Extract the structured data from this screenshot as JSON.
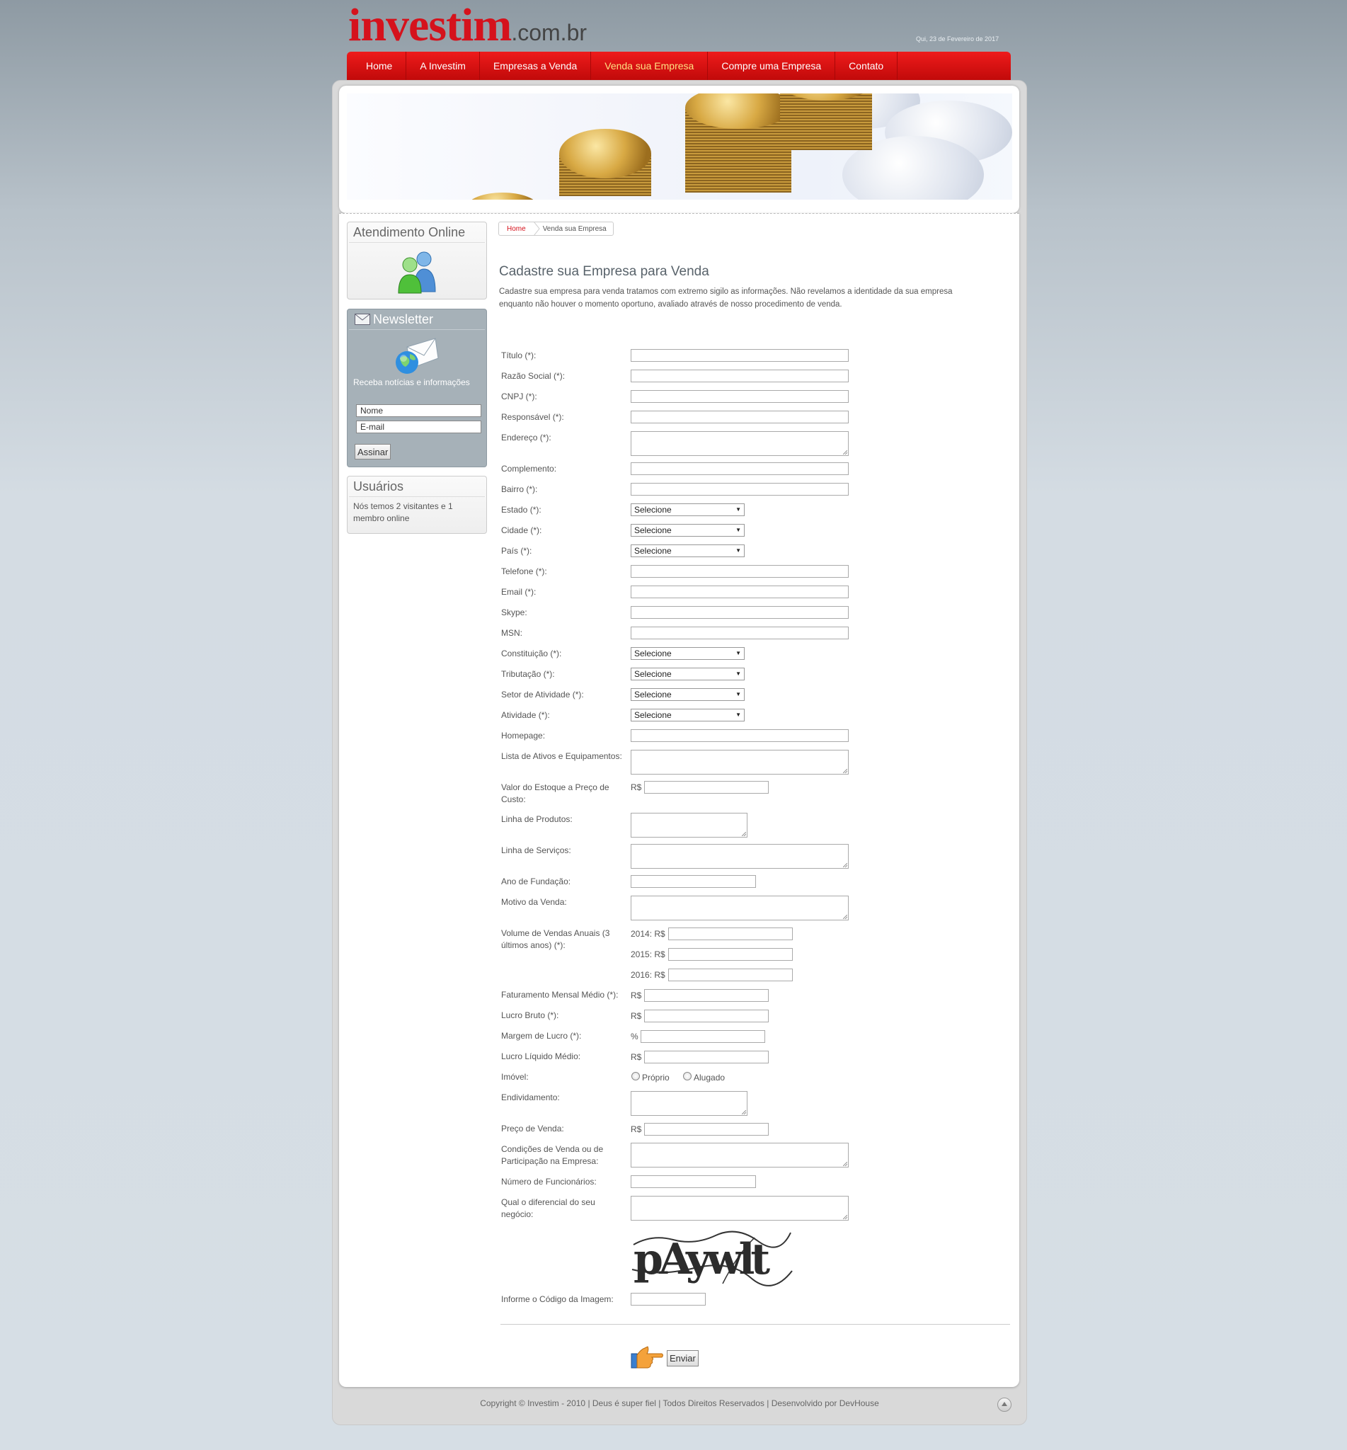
{
  "header": {
    "logo_main": "investim",
    "logo_sub": ".com.br",
    "date": "Qui, 23 de Fevereiro de 2017"
  },
  "nav": [
    {
      "label": "Home",
      "active": false
    },
    {
      "label": "A Investim",
      "active": false
    },
    {
      "label": "Empresas a Venda",
      "active": false
    },
    {
      "label": "Venda sua Empresa",
      "active": true
    },
    {
      "label": "Compre uma Empresa",
      "active": false
    },
    {
      "label": "Contato",
      "active": false
    }
  ],
  "sidebar": {
    "online": {
      "title": "Atendimento Online",
      "icon": "users-icon"
    },
    "newsletter": {
      "title": "Newsletter",
      "icon": "newsletter-globe-icon",
      "text": "Receba notícias e informações",
      "name_value": "Nome",
      "email_value": "E-mail",
      "button": "Assinar"
    },
    "users": {
      "title": "Usuários",
      "text": "Nós temos 2 visitantes e 1 membro online"
    }
  },
  "breadcrumb": {
    "home": "Home",
    "current": "Venda sua Empresa"
  },
  "main": {
    "title": "Cadastre sua Empresa para Venda",
    "intro": "Cadastre sua empresa para venda tratamos com extremo sigilo as informações. Não revelamos a identidade da sua empresa enquanto não houver o momento oportuno, avaliado através de nosso procedimento de venda."
  },
  "form": {
    "titulo": "Título (*):",
    "razao": "Razão Social (*):",
    "cnpj": "CNPJ (*):",
    "responsavel": "Responsável (*):",
    "endereco": "Endereço (*):",
    "complemento": "Complemento:",
    "bairro": "Bairro (*):",
    "estado": "Estado (*):",
    "cidade": "Cidade (*):",
    "pais": "País (*):",
    "telefone": "Telefone (*):",
    "email": "Email (*):",
    "skype": "Skype:",
    "msn": "MSN:",
    "constituicao": "Constituição (*):",
    "tributacao": "Tributação (*):",
    "setor": "Setor de Atividade (*):",
    "atividade": "Atividade (*):",
    "homepage": "Homepage:",
    "ativos": "Lista de Ativos e Equipamentos:",
    "estoque": "Valor do Estoque a Preço de Custo:",
    "produtos": "Linha de Produtos:",
    "servicos": "Linha de Serviços:",
    "fundacao": "Ano de Fundação:",
    "motivo": "Motivo da Venda:",
    "volume": "Volume de Vendas Anuais (3 últimos anos) (*):",
    "faturamento": "Faturamento Mensal Médio (*):",
    "lucro_bruto": "Lucro Bruto (*):",
    "margem": "Margem de Lucro (*):",
    "lucro_liquido": "Lucro Líquido Médio:",
    "imovel": "Imóvel:",
    "endividamento": "Endividamento:",
    "preco": "Preço de Venda:",
    "condicoes": "Condições de Venda ou de Participação na Empresa:",
    "funcionarios": "Número de Funcionários:",
    "diferencial": "Qual o diferencial do seu negócio:",
    "captcha_label": "Informe o Código da Imagem:",
    "select_default": "Selecione",
    "currency": "R$",
    "percent": "%",
    "year1": "2014: R$",
    "year2": "2015: R$",
    "year3": "2016: R$",
    "opt_proprio": "Próprio",
    "opt_alugado": "Alugado",
    "captcha_text": "pAywlt",
    "submit": "Enviar"
  },
  "footer": {
    "text": "Copyright © Investim - 2010 | Deus é super fiel | Todos Direitos Reservados | Desenvolvido por DevHouse"
  }
}
